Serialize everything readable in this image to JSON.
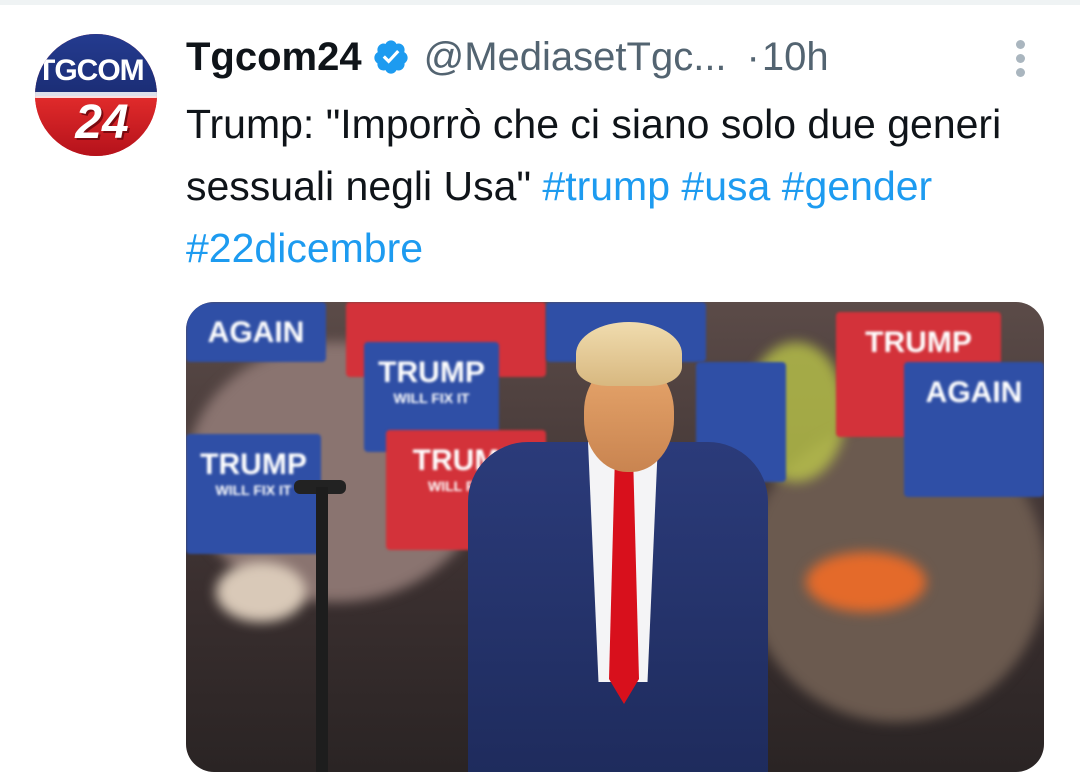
{
  "tweet": {
    "author_name": "Tgcom24",
    "handle": "@MediasetTgc...",
    "separator": "·",
    "time": "10h",
    "text_parts": [
      {
        "type": "text",
        "value": "Trump: \"Imporrò che ci siano solo due generi sessuali negli Usa\" "
      },
      {
        "type": "hashtag",
        "value": "#trump"
      },
      {
        "type": "space",
        "value": " "
      },
      {
        "type": "hashtag",
        "value": "#usa"
      },
      {
        "type": "space",
        "value": " "
      },
      {
        "type": "hashtag",
        "value": "#gender"
      },
      {
        "type": "space",
        "value": " "
      },
      {
        "type": "hashtag",
        "value": "#22dicembre"
      }
    ]
  },
  "avatar": {
    "logo_line1": "TGCOM",
    "logo_line2": "24"
  },
  "media": {
    "signs": [
      {
        "line1": "TRUMP",
        "line2": "WILL FIX IT",
        "color": "blue"
      },
      {
        "line1": "TRUMP",
        "line2": "WILL FIX IT",
        "color": "red"
      },
      {
        "line1": "TRUMP",
        "line2": "WILL FIX IT",
        "color": "blue"
      },
      {
        "line1": "TRUMP",
        "line2": "",
        "color": "red"
      },
      {
        "line1": "AGAIN",
        "line2": "",
        "color": "blue"
      }
    ]
  },
  "colors": {
    "hashtag": "#1d9bf0",
    "verified": "#1d9bf0",
    "secondary_text": "#536471"
  },
  "icons": [
    "verified-badge-icon",
    "more-options-icon"
  ]
}
